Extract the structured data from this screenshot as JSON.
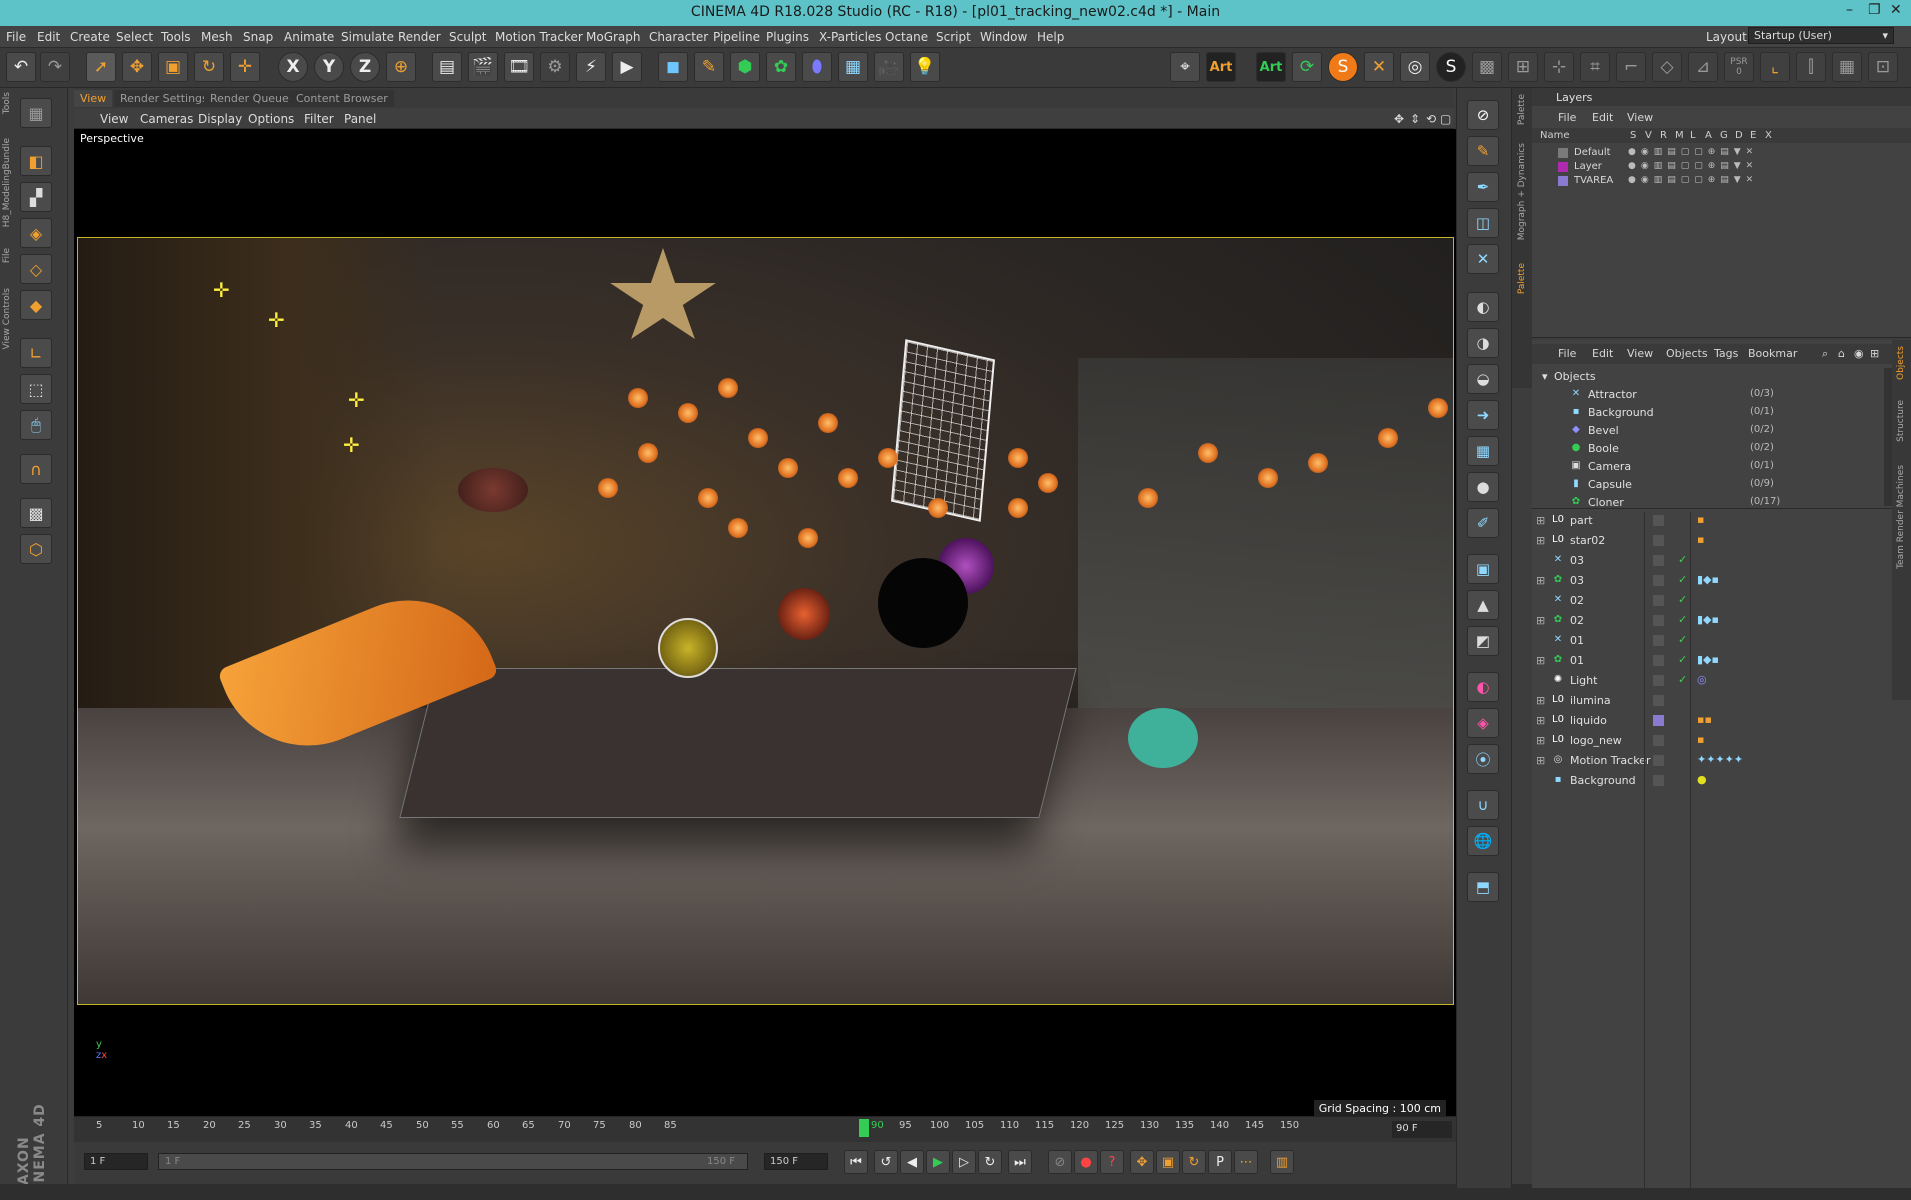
{
  "window": {
    "title": "CINEMA 4D R18.028 Studio (RC - R18) - [pl01_tracking_new02.c4d *] - Main"
  },
  "menubar": {
    "items": [
      "File",
      "Edit",
      "Create",
      "Select",
      "Tools",
      "Mesh",
      "Snap",
      "Animate",
      "Simulate",
      "Render",
      "Sculpt",
      "Motion Tracker",
      "MoGraph",
      "Character",
      "Pipeline",
      "Plugins",
      "X-Particles",
      "Octane",
      "Script",
      "Window",
      "Help"
    ],
    "layout_label": "Layout:",
    "layout_value": "Startup (User)"
  },
  "toolbar": {
    "axis_x": "X",
    "axis_y": "Y",
    "axis_z": "Z",
    "art1": "Art",
    "art2": "Art",
    "psr": "PSR",
    "psr_num": "0"
  },
  "left_tabs": [
    "Tools",
    "H8_ModelingBundle",
    "File",
    "View Controls"
  ],
  "viewport": {
    "tabs": [
      "View",
      "Render Settings",
      "Render Queue",
      "Content Browser"
    ],
    "menu": [
      "View",
      "Cameras",
      "Display",
      "Options",
      "Filter",
      "Panel"
    ],
    "camera_label": "Perspective",
    "grid_spacing": "Grid Spacing : 100 cm"
  },
  "timeline": {
    "ticks": [
      "5",
      "10",
      "15",
      "20",
      "25",
      "30",
      "35",
      "40",
      "45",
      "50",
      "55",
      "60",
      "65",
      "70",
      "75",
      "80",
      "85",
      "90",
      "95",
      "100",
      "105",
      "110",
      "115",
      "120",
      "125",
      "130",
      "135",
      "140",
      "145",
      "150"
    ],
    "current_frame": 90,
    "current_label": "90",
    "end_label": "90 F"
  },
  "transport": {
    "start_field": "1 F",
    "range_start": "1 F",
    "range_end": "150 F",
    "end_field": "150 F"
  },
  "branding": "MAXON CINEMA 4D",
  "palette_tabs": [
    "Palette",
    "Mograph + Dynamics",
    "Palette"
  ],
  "layers": {
    "title": "Layers",
    "menu": [
      "File",
      "Edit",
      "View"
    ],
    "columns": [
      "Name",
      "S",
      "V",
      "R",
      "M",
      "L",
      "A",
      "G",
      "D",
      "E",
      "X"
    ],
    "rows": [
      {
        "name": "Default",
        "color": "#7a7a7a"
      },
      {
        "name": "Layer",
        "color": "#b02ab0"
      },
      {
        "name": "TVAREA",
        "color": "#8a7ad0"
      }
    ]
  },
  "objects": {
    "menu": [
      "File",
      "Edit",
      "View",
      "Objects",
      "Tags",
      "Bookmar"
    ],
    "right_tabs": [
      "Objects",
      "Structure",
      "Team Render Machines"
    ],
    "library_root": "Objects",
    "library": [
      {
        "name": "Attractor",
        "count": "(0/3)",
        "icon": "✕"
      },
      {
        "name": "Background",
        "count": "(0/1)",
        "icon": "▪"
      },
      {
        "name": "Bevel",
        "count": "(0/2)",
        "icon": "◆"
      },
      {
        "name": "Boole",
        "count": "(0/2)",
        "icon": "●"
      },
      {
        "name": "Camera",
        "count": "(0/1)",
        "icon": "▣"
      },
      {
        "name": "Capsule",
        "count": "(0/9)",
        "icon": "▮"
      },
      {
        "name": "Cloner",
        "count": "(0/17)",
        "icon": "✿"
      }
    ],
    "scene": [
      {
        "name": "part",
        "icon": "L0",
        "check": ""
      },
      {
        "name": "star02",
        "icon": "L0",
        "check": ""
      },
      {
        "name": "03",
        "icon": "✕",
        "check": "✓"
      },
      {
        "name": "03",
        "icon": "✿",
        "check": "✓"
      },
      {
        "name": "02",
        "icon": "✕",
        "check": "✓"
      },
      {
        "name": "02",
        "icon": "✿",
        "check": "✓"
      },
      {
        "name": "01",
        "icon": "✕",
        "check": "✓"
      },
      {
        "name": "01",
        "icon": "✿",
        "check": "✓"
      },
      {
        "name": "Light",
        "icon": "✺",
        "check": "✓"
      },
      {
        "name": "ilumina",
        "icon": "L0",
        "check": ""
      },
      {
        "name": "liquido",
        "icon": "L0",
        "check": ""
      },
      {
        "name": "logo_new",
        "icon": "L0",
        "check": ""
      },
      {
        "name": "Motion Tracker",
        "icon": "◎",
        "check": ""
      },
      {
        "name": "Background",
        "icon": "▪",
        "check": ""
      }
    ]
  },
  "colors": {
    "accent": "#f0a030",
    "titlebar": "#5ec3c8",
    "safe_frame": "#c8b428",
    "playhead": "#33cc55"
  }
}
